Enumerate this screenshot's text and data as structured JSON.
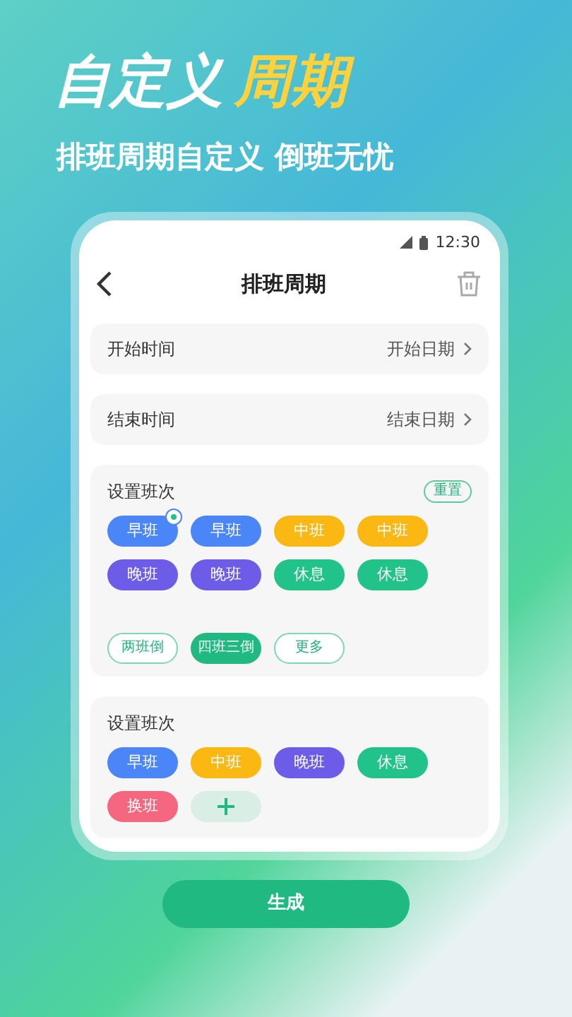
{
  "headline": {
    "plain": "自定义",
    "highlight": "周期"
  },
  "subtitle": "排班周期自定义 倒班无忧",
  "status_bar": {
    "time": "12:30"
  },
  "header": {
    "title": "排班周期"
  },
  "date_rows": [
    {
      "label": "开始时间",
      "value": "开始日期"
    },
    {
      "label": "结束时间",
      "value": "结束日期"
    }
  ],
  "cycle_section": {
    "title": "设置班次",
    "reset": "重置",
    "shifts": [
      {
        "label": "早班",
        "color": "#4a86f7",
        "badge": true
      },
      {
        "label": "早班",
        "color": "#4a86f7",
        "badge": false
      },
      {
        "label": "中班",
        "color": "#fbb813",
        "badge": false
      },
      {
        "label": "中班",
        "color": "#fbb813",
        "badge": false
      },
      {
        "label": "晚班",
        "color": "#6c5ce7",
        "badge": false
      },
      {
        "label": "晚班",
        "color": "#6c5ce7",
        "badge": false
      },
      {
        "label": "休息",
        "color": "#22c38a",
        "badge": false
      },
      {
        "label": "休息",
        "color": "#22c38a",
        "badge": false
      }
    ],
    "modes": [
      {
        "label": "两班倒",
        "selected": false
      },
      {
        "label": "四班三倒",
        "selected": true
      },
      {
        "label": "更多",
        "selected": false
      }
    ]
  },
  "shift_section": {
    "title": "设置班次",
    "shifts": [
      {
        "label": "早班",
        "color": "#4a86f7"
      },
      {
        "label": "中班",
        "color": "#fbb813"
      },
      {
        "label": "晚班",
        "color": "#6c5ce7"
      },
      {
        "label": "休息",
        "color": "#22c38a"
      },
      {
        "label": "换班",
        "color": "#f5677f"
      }
    ]
  },
  "generate_button": "生成"
}
